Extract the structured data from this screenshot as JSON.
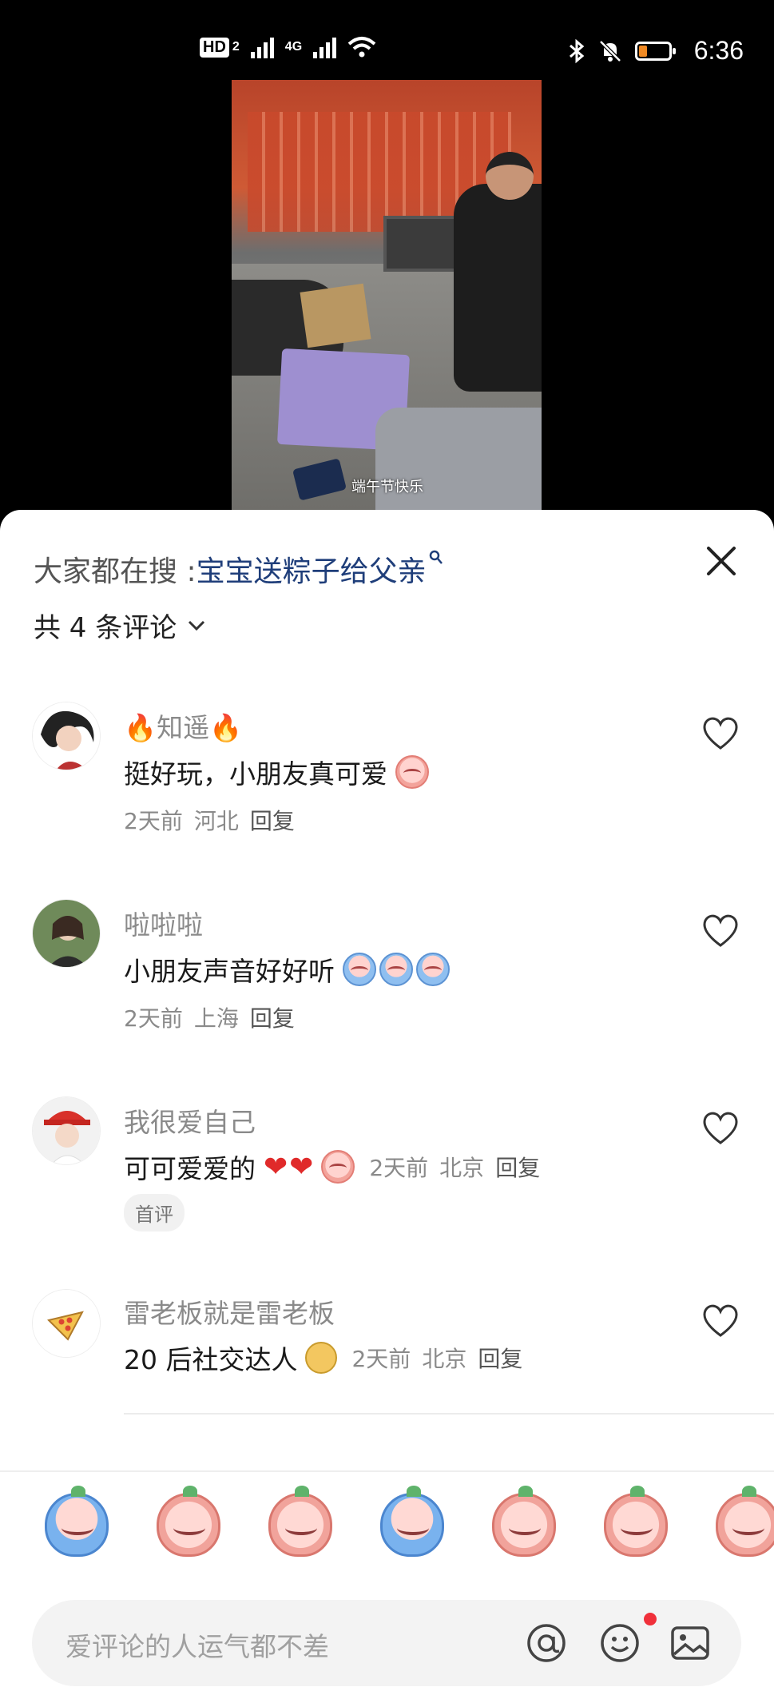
{
  "status_bar": {
    "hd_label": "HD",
    "sim_slot": "2",
    "network": "4G",
    "time": "6:36"
  },
  "video": {
    "caption": "端午节快乐"
  },
  "comments_panel": {
    "search_prefix": "大家都在搜 : ",
    "search_query": "宝宝送粽子给父亲",
    "count_label": "共 4 条评论",
    "comments": [
      {
        "name": "知遥",
        "text": "挺好玩，小朋友真可爱",
        "time": "2天前",
        "location": "河北",
        "reply": "回复"
      },
      {
        "name": "啦啦啦",
        "text": "小朋友声音好好听",
        "time": "2天前",
        "location": "上海",
        "reply": "回复"
      },
      {
        "name": "我很爱自己",
        "text": "可可爱爱的",
        "time": "2天前",
        "location": "北京",
        "reply": "回复",
        "tag": "首评"
      },
      {
        "name": "雷老板就是雷老板",
        "text": "20 后社交达人",
        "time": "2天前",
        "location": "北京",
        "reply": "回复"
      }
    ]
  },
  "input": {
    "placeholder": "爱评论的人运气都不差"
  },
  "colors": {
    "accent_link": "#1f3e7a",
    "like_outline": "#333333",
    "notification_dot": "#f0303a"
  }
}
